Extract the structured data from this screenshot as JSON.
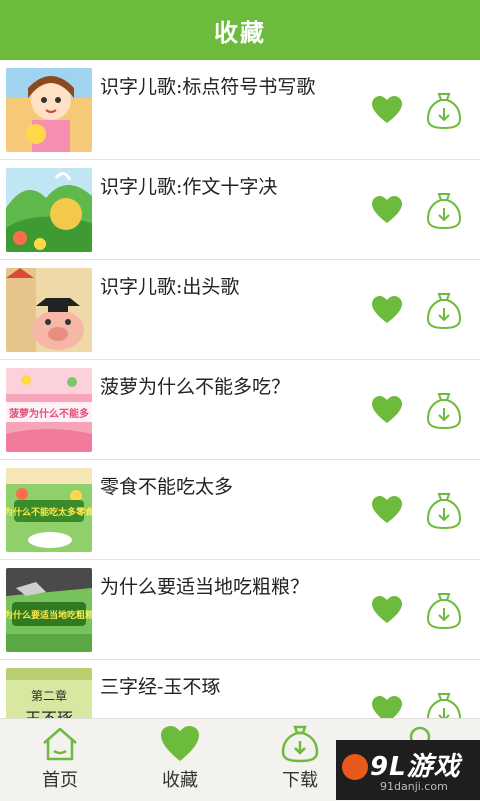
{
  "header": {
    "title": "收藏"
  },
  "items": [
    {
      "title": "识字儿歌:标点符号书写歌",
      "thumb_bg": "#f6c978"
    },
    {
      "title": "识字儿歌:作文十字决",
      "thumb_bg": "#7cc96a"
    },
    {
      "title": "识字儿歌:出头歌",
      "thumb_bg": "#f0d9a8"
    },
    {
      "title": "菠萝为什么不能多吃？",
      "thumb_bg": "#f6a4b8",
      "thumb_caption": "菠萝为什么不能多"
    },
    {
      "title": "零食不能吃太多",
      "thumb_bg": "#8fd06b",
      "thumb_caption": "为什么不能吃太多零食"
    },
    {
      "title": "为什么要适当地吃粗粮？",
      "thumb_bg": "#78c25c",
      "thumb_caption": "为什么要适当地吃粗粮"
    },
    {
      "title": "三字经-玉不琢",
      "thumb_bg": "#d8e8a0",
      "thumb_chapter": "第二章",
      "thumb_caption": "玉不琢"
    }
  ],
  "tabbar": {
    "home": "首页",
    "favorites": "收藏",
    "download": "下载"
  },
  "watermark": {
    "main": "9L游戏",
    "sub": "91danji.com"
  },
  "colors": {
    "accent": "#6dbb3c",
    "icon": "#6dbb3c"
  }
}
